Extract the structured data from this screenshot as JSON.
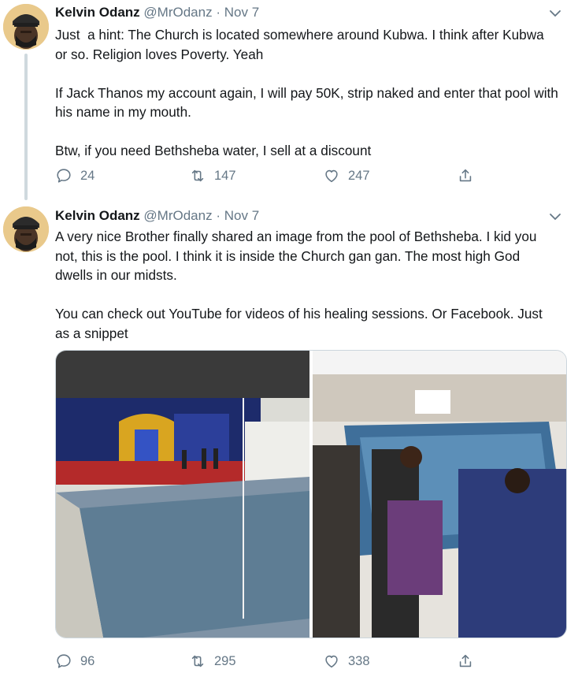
{
  "tweets": [
    {
      "author": "Kelvin Odanz",
      "handle": "@MrOdanz",
      "separator": "·",
      "date": "Nov 7",
      "text": "Just  a hint: The Church is located somewhere around Kubwa. I think after Kubwa or so. Religion loves Poverty. Yeah\n\nIf Jack Thanos my account again, I will pay 50K, strip naked and enter that pool with his name in my mouth.\n\nBtw, if you need Bethsheba water, I sell at a discount",
      "replies": "24",
      "retweets": "147",
      "likes": "247"
    },
    {
      "author": "Kelvin Odanz",
      "handle": "@MrOdanz",
      "separator": "·",
      "date": "Nov 7",
      "text": "A very nice Brother finally shared an image from the pool of Bethsheba. I kid you not, this is the pool. I think it is inside the Church gan gan. The most high God dwells in our midsts.\n\nYou can check out YouTube for videos of his healing sessions. Or Facebook. Just as a snippet",
      "replies": "96",
      "retweets": "295",
      "likes": "338"
    }
  ],
  "icons": [
    "chevron-down-icon",
    "reply-icon",
    "retweet-icon",
    "like-icon",
    "share-icon"
  ],
  "colors": {
    "text": "#14171a",
    "muted": "#657786",
    "border": "#ccd6dd",
    "thread": "#cfd9de"
  }
}
